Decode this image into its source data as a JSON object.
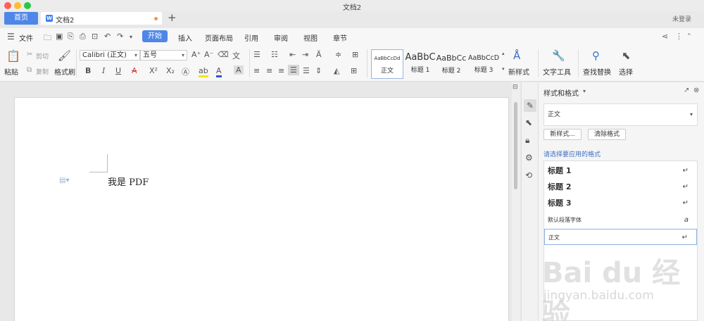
{
  "window": {
    "title": "文档2"
  },
  "tabs": {
    "home": "首页",
    "doc": "文档2",
    "add": "+",
    "login": "未登录"
  },
  "menu": {
    "file": "文件",
    "tabs": [
      "开始",
      "插入",
      "页面布局",
      "引用",
      "审阅",
      "视图",
      "章节"
    ]
  },
  "toolbar": {
    "paste": "粘贴",
    "cut": "剪切",
    "copy": "复制",
    "format_painter": "格式刷",
    "font_name": "Calibri (正文)",
    "font_size": "五号",
    "styles": [
      {
        "sample": "AaBbCcDd",
        "name": "正文"
      },
      {
        "sample": "AaBbC",
        "name": "标题 1"
      },
      {
        "sample": "AaBbCc",
        "name": "标题 2"
      },
      {
        "sample": "AaBbCcD",
        "name": "标题 3"
      }
    ],
    "new_style": "新样式",
    "text_tools": "文字工具",
    "find_replace": "查找替换",
    "select": "选择"
  },
  "document": {
    "text": "我是 PDF"
  },
  "panel": {
    "title": "样式和格式",
    "current_style": "正文",
    "new_style_btn": "新样式...",
    "clear_format_btn": "清除格式",
    "hint": "请选择要应用的格式",
    "styles": [
      {
        "name": "标题 1",
        "mark": "↵"
      },
      {
        "name": "标题 2",
        "mark": "↵"
      },
      {
        "name": "标题 3",
        "mark": "↵"
      },
      {
        "name": "默认段落字体",
        "mark": "a"
      },
      {
        "name": "正文",
        "mark": "↵"
      }
    ]
  },
  "watermark": {
    "main": "Bai du 经验",
    "sub": "jingyan.baidu.com"
  },
  "colors": {
    "accent": "#4f86e8",
    "unsaved_dot": "#f29746"
  },
  "icons": [
    "close-window",
    "minimize-window",
    "zoom-window",
    "menu",
    "open",
    "save",
    "undo",
    "redo",
    "print",
    "share",
    "more",
    "search",
    "cursor",
    "pen",
    "lock",
    "settings",
    "history"
  ]
}
